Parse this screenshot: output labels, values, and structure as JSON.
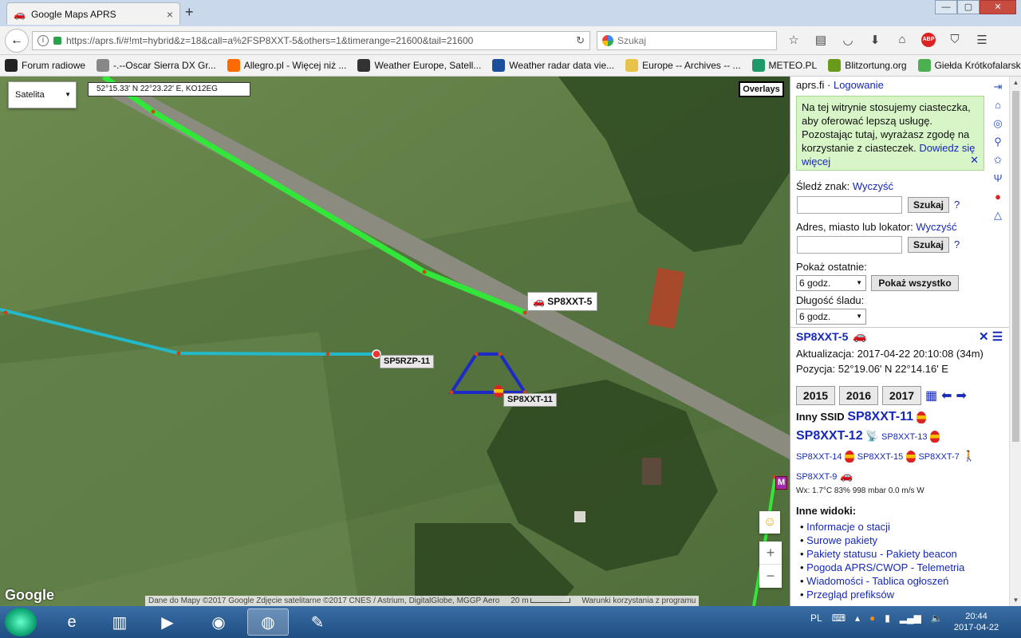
{
  "browser": {
    "tab_title": "Google Maps APRS",
    "tab_close": "×",
    "new_tab": "+",
    "url": "https://aprs.fi/#!mt=hybrid&z=18&call=a%2FSP8XXT-5&others=1&timerange=21600&tail=21600",
    "search_placeholder": "Szukaj",
    "window_controls": [
      "—",
      "▢",
      "✕"
    ]
  },
  "bookmarks": [
    {
      "label": "Forum radiowe",
      "color": "#222"
    },
    {
      "label": "-.--Oscar Sierra DX Gr...",
      "color": "#888"
    },
    {
      "label": "Allegro.pl - Więcej niż ...",
      "color": "#ff6a00"
    },
    {
      "label": "Weather Europe, Satell...",
      "color": "#333"
    },
    {
      "label": "Weather radar data vie...",
      "color": "#1b4f9c"
    },
    {
      "label": "Europe -- Archives -- ...",
      "color": "#e8c34a"
    },
    {
      "label": "METEO.PL",
      "color": "#1e9a6a"
    },
    {
      "label": "Blitzortung.org",
      "color": "#6a9a1a"
    },
    {
      "label": "Giełda Krótkofalarska ...",
      "color": "#4caf50"
    }
  ],
  "map": {
    "coords": "52°15.33' N 22°23.22' E, KO12EG",
    "map_type": "Satelita",
    "overlays": "Overlays",
    "google": "Google",
    "attribution": "Dane do Mapy ©2017 Google Zdjęcie satelitarne ©2017 CNES / Astrium, DigitalGlobe, MGGP Aero",
    "scale": "20 m",
    "terms": "Warunki korzystania z programu",
    "zoom_in": "+",
    "zoom_out": "−",
    "labels": {
      "car": "SP8XXT-5",
      "rzp": "SP5RZP-11",
      "balloon": "SP8XXT-11",
      "edge": "M"
    }
  },
  "sidebar": {
    "site": "aprs.fi",
    "sep": " · ",
    "login": "Logowanie",
    "cookie_text": "Na tej witrynie stosujemy ciasteczka, aby oferować lepszą usługę. Pozostając tutaj, wyrażasz zgodę na korzystanie z ciasteczek.",
    "cookie_link": "Dowiedz się więcej",
    "cookie_close": "✕",
    "track_label": "Śledź znak:",
    "track_clear": "Wyczyść",
    "search_btn": "Szukaj",
    "help": "?",
    "address_label": "Adres, miasto lub lokator:",
    "address_clear": "Wyczyść",
    "show_last_label": "Pokaż ostatnie:",
    "show_last_value": "6 godz.",
    "show_all_btn": "Pokaż wszystko",
    "trail_label": "Długość śladu:",
    "trail_value": "6 godz.",
    "station": {
      "call": "SP8XXT-5",
      "updated": "Aktualizacja: 2017-04-22 20:10:08 (34m)",
      "position": "Pozycja: 52°19.06' N 22°14.16' E",
      "close": "✕",
      "menu": "☰"
    },
    "years": [
      "2015",
      "2016",
      "2017"
    ],
    "other_ssid_label": "Inny SSID",
    "ssids": {
      "s11": "SP8XXT-11",
      "s12": "SP8XXT-12",
      "s13": "SP8XXT-13",
      "s14": "SP8XXT-14",
      "s15": "SP8XXT-15",
      "s7": "SP8XXT-7",
      "s9": "SP8XXT-9"
    },
    "wx": "Wx: 1.7°C 83% 998 mbar 0.0 m/s W",
    "other_views_label": "Inne widoki:",
    "views": [
      "Informacje o stacji",
      "Surowe pakiety",
      "Pakiety statusu - Pakiety beacon",
      "Pogoda APRS/CWOP - Telemetria",
      "Wiadomości - Tablica ogłoszeń",
      "Przegląd prefiksów"
    ]
  },
  "taskbar": {
    "lang": "PL",
    "time": "20:44",
    "date": "2017-04-22"
  },
  "colors": {
    "track_green": "#33e63a",
    "track_cyan": "#23b9c8",
    "balloon_track": "#1e2ac8",
    "link": "#1528b8"
  }
}
